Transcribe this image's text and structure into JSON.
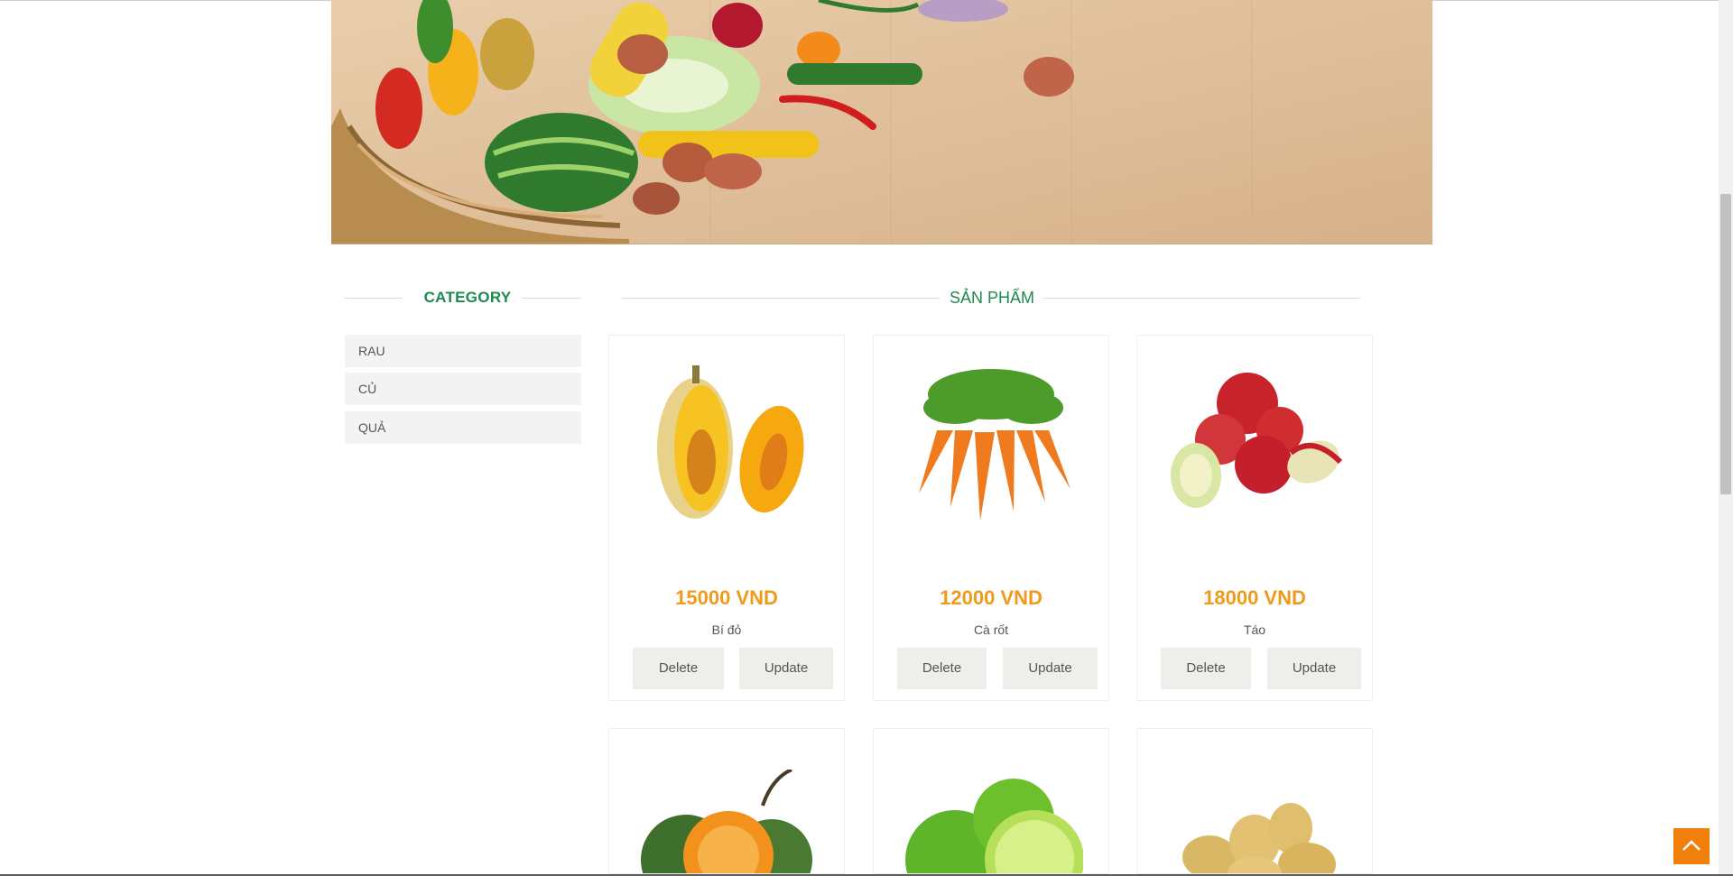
{
  "sidebar": {
    "title": "CATEGORY",
    "items": [
      {
        "label": "RAU"
      },
      {
        "label": "CỦ"
      },
      {
        "label": "QUẢ"
      }
    ]
  },
  "products_section": {
    "title": "SẢN PHẨM",
    "items": [
      {
        "price": "15000 VND",
        "name": "Bí đỏ",
        "delete_label": "Delete",
        "update_label": "Update",
        "image": "pumpkin-image"
      },
      {
        "price": "12000 VND",
        "name": "Cà rốt",
        "delete_label": "Delete",
        "update_label": "Update",
        "image": "carrot-image"
      },
      {
        "price": "18000 VND",
        "name": "Táo",
        "delete_label": "Delete",
        "update_label": "Update",
        "image": "apple-image"
      },
      {
        "image": "orange-image"
      },
      {
        "image": "lime-image"
      },
      {
        "image": "potato-image"
      }
    ]
  },
  "colors": {
    "accent_green": "#1e8a4f",
    "price_orange": "#f09a1c",
    "scroll_top": "#f0800a"
  },
  "icons": {
    "scroll_top": "chevron-up-icon"
  }
}
